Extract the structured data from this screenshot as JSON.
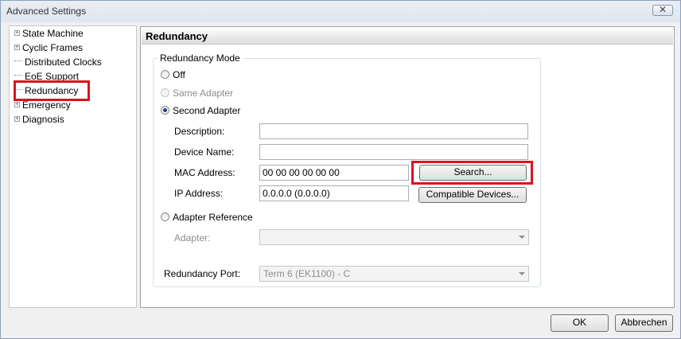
{
  "window": {
    "title": "Advanced Settings",
    "close_icon": "close-icon"
  },
  "tree": {
    "items": [
      {
        "label": "State Machine",
        "expandable": true
      },
      {
        "label": "Cyclic Frames",
        "expandable": true
      },
      {
        "label": "Distributed Clocks",
        "expandable": false
      },
      {
        "label": "EoE Support",
        "expandable": false
      },
      {
        "label": "Redundancy",
        "expandable": false,
        "selected": true
      },
      {
        "label": "Emergency",
        "expandable": true
      },
      {
        "label": "Diagnosis",
        "expandable": true
      }
    ]
  },
  "panel": {
    "title": "Redundancy",
    "group_label": "Redundancy Mode",
    "radios": {
      "off": "Off",
      "same_adapter": "Same Adapter",
      "second_adapter": "Second Adapter",
      "adapter_reference": "Adapter Reference"
    },
    "selected_mode": "second_adapter",
    "fields": {
      "description_label": "Description:",
      "description_value": "",
      "device_name_label": "Device Name:",
      "device_name_value": "",
      "mac_label": "MAC Address:",
      "mac_value": "00 00 00 00 00 00",
      "ip_label": "IP Address:",
      "ip_value": "0.0.0.0 (0.0.0.0)",
      "adapter_label": "Adapter:",
      "adapter_value": "",
      "redundancy_port_label": "Redundancy Port:",
      "redundancy_port_value": "Term 6 (EK1100) - C"
    },
    "buttons": {
      "search": "Search...",
      "compatible_devices": "Compatible Devices..."
    }
  },
  "footer": {
    "ok": "OK",
    "cancel": "Abbrechen"
  },
  "colors": {
    "highlight": "#d9141e",
    "radio_dot": "#23408a"
  }
}
